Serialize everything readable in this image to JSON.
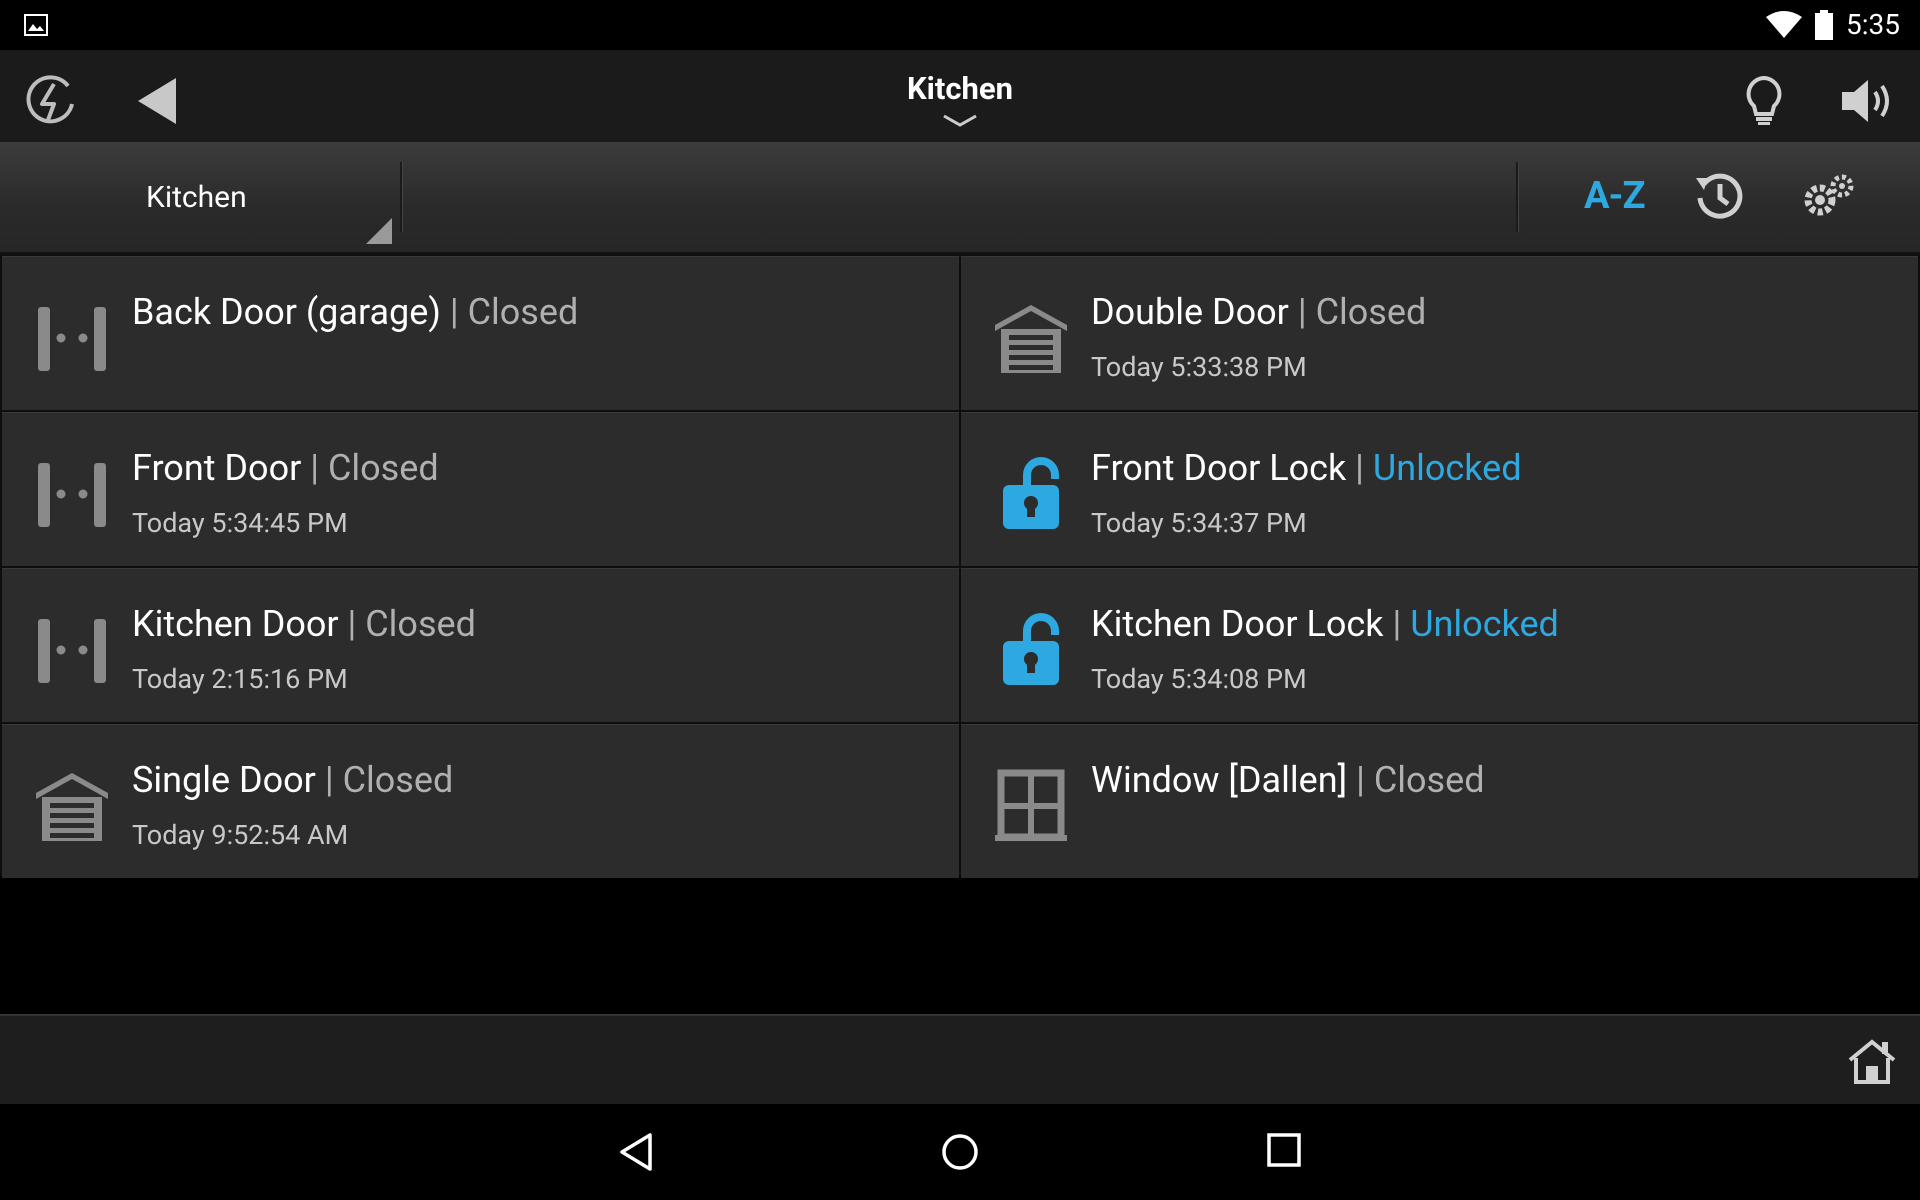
{
  "status_bar": {
    "time": "5:35"
  },
  "header": {
    "title": "Kitchen"
  },
  "toolbar": {
    "room": "Kitchen",
    "sort_label": "A-Z"
  },
  "tiles": [
    {
      "name": "Back Door (garage)",
      "state": "Closed",
      "time": "",
      "icon": "door-sensor-icon",
      "state_color": "#b0b0b0"
    },
    {
      "name": "Double Door",
      "state": "Closed",
      "time": "Today 5:33:38 PM",
      "icon": "garage-door-icon",
      "state_color": "#b0b0b0"
    },
    {
      "name": "Front Door",
      "state": "Closed",
      "time": "Today 5:34:45 PM",
      "icon": "door-sensor-icon",
      "state_color": "#b0b0b0"
    },
    {
      "name": "Front Door Lock",
      "state": "Unlocked",
      "time": "Today 5:34:37 PM",
      "icon": "unlocked-lock-icon",
      "state_color": "#2ea8e0"
    },
    {
      "name": "Kitchen Door",
      "state": "Closed",
      "time": "Today 2:15:16 PM",
      "icon": "door-sensor-icon",
      "state_color": "#b0b0b0"
    },
    {
      "name": "Kitchen Door Lock",
      "state": "Unlocked",
      "time": "Today 5:34:08 PM",
      "icon": "unlocked-lock-icon",
      "state_color": "#2ea8e0"
    },
    {
      "name": "Single Door",
      "state": "Closed",
      "time": "Today 9:52:54 AM",
      "icon": "garage-door-icon",
      "state_color": "#b0b0b0"
    },
    {
      "name": "Window [Dallen]",
      "state": "Closed",
      "time": "",
      "icon": "window-icon",
      "state_color": "#b0b0b0"
    }
  ],
  "separator": "|",
  "colors": {
    "accent": "#2ea8e0",
    "tile_bg": "#2c2c2c",
    "icon_gray": "#8a8a8a"
  }
}
